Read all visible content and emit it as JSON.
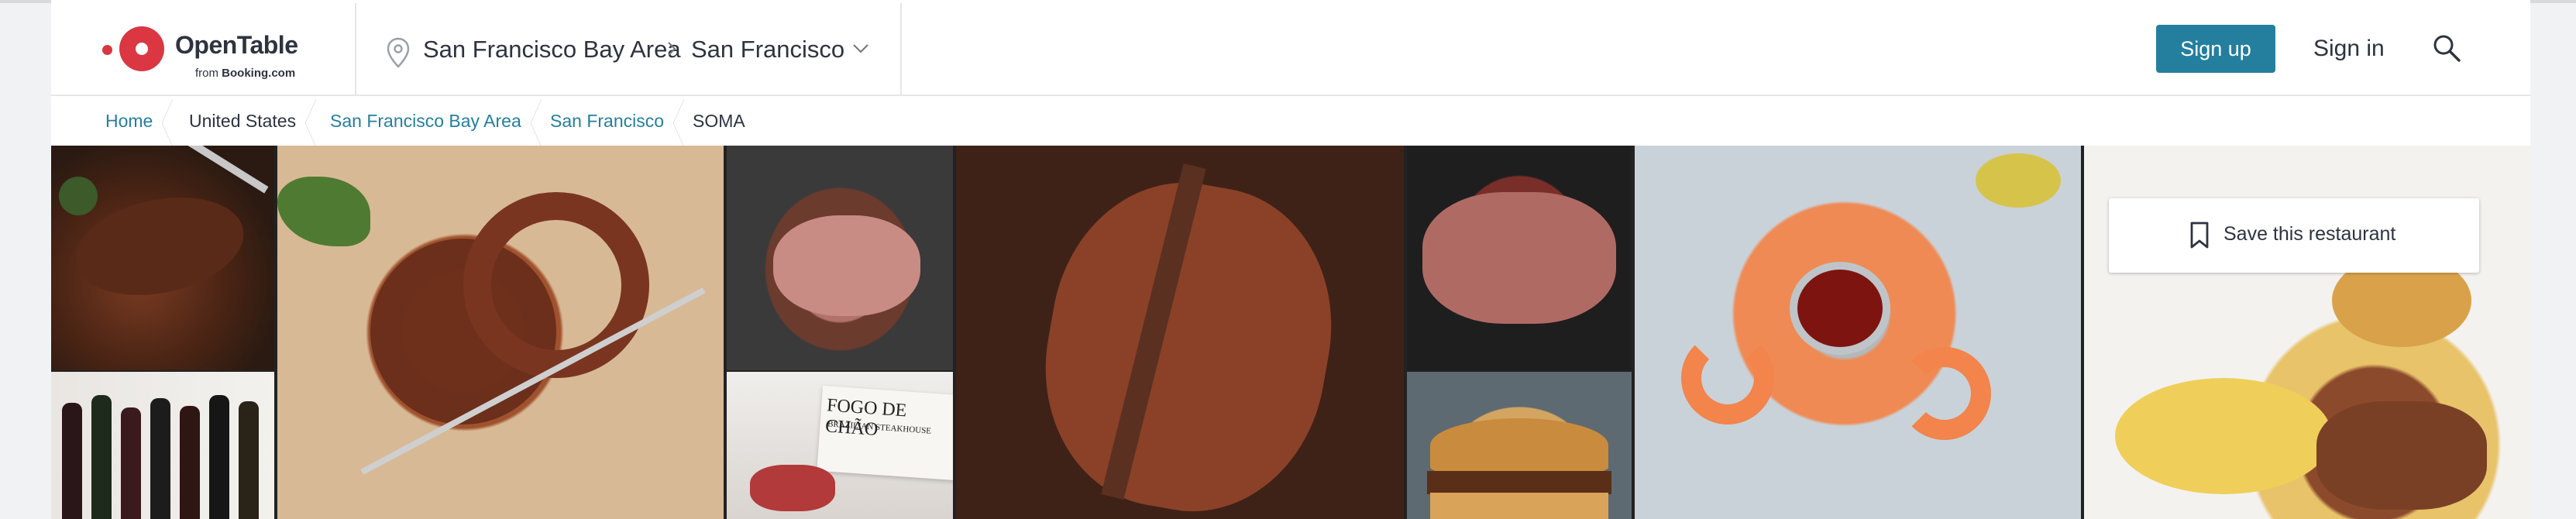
{
  "brand": {
    "name": "OpenTable",
    "tagline_prefix": "from",
    "tagline_brand": "Booking.com",
    "color": "#da3743"
  },
  "location": {
    "region": "San Francisco Bay Area",
    "city": "San Francisco"
  },
  "header": {
    "signup_label": "Sign up",
    "signin_label": "Sign in",
    "accent_color": "#247f9e"
  },
  "breadcrumb": [
    {
      "label": "Home",
      "link": true
    },
    {
      "label": "United States",
      "link": false
    },
    {
      "label": "San Francisco Bay Area",
      "link": true
    },
    {
      "label": "San Francisco",
      "link": true
    },
    {
      "label": "SOMA",
      "link": false
    }
  ],
  "gallery": {
    "save_label": "Save this restaurant",
    "photos": [
      "sliced-steak-photo",
      "wine-bottles-photo",
      "sausage-skewers-photo",
      "roast-beef-photo",
      "fogo-de-chao-menu-photo",
      "t-bone-steak-photo",
      "wagyu-steak-photo",
      "burger-photo",
      "shrimp-cocktail-photo",
      "lamb-chops-brunch-photo"
    ],
    "menu_sign_text": "FOGO DE CHÃO",
    "menu_sign_sub": "BRAZILIAN STEAKHOUSE"
  },
  "icons": {
    "location": "map-pin-icon",
    "separator": "chevron-right-icon",
    "dropdown": "chevron-down-icon",
    "search": "search-icon",
    "bookmark": "bookmark-icon"
  }
}
